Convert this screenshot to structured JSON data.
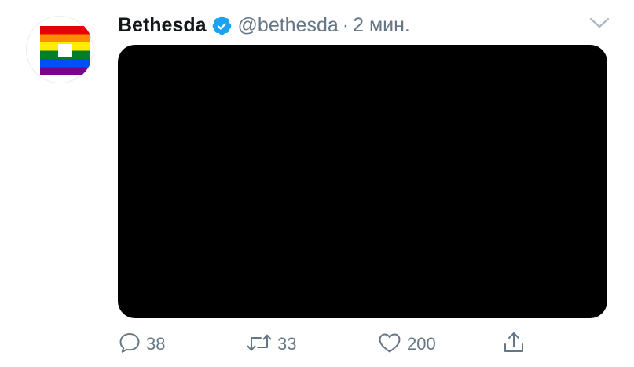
{
  "tweet": {
    "author": {
      "name": "Bethesda",
      "handle": "@bethesda",
      "verified": true,
      "avatar": {
        "icon": "rainbow-flag-logo",
        "stripe_colors": [
          "#e40303",
          "#ff8c00",
          "#ffed00",
          "#008026",
          "#004dff",
          "#750787"
        ]
      }
    },
    "separator": "·",
    "timestamp": "2 мин.",
    "media": {
      "color": "#000000"
    },
    "actions": {
      "reply": {
        "icon": "reply-icon",
        "count": "38"
      },
      "retweet": {
        "icon": "retweet-icon",
        "count": "33"
      },
      "like": {
        "icon": "heart-icon",
        "count": "200"
      },
      "share": {
        "icon": "share-icon"
      }
    },
    "menu": {
      "icon": "chevron-down-icon"
    }
  },
  "colors": {
    "text_primary": "#14171a",
    "text_secondary": "#657786",
    "verified_blue": "#1da1f2"
  }
}
